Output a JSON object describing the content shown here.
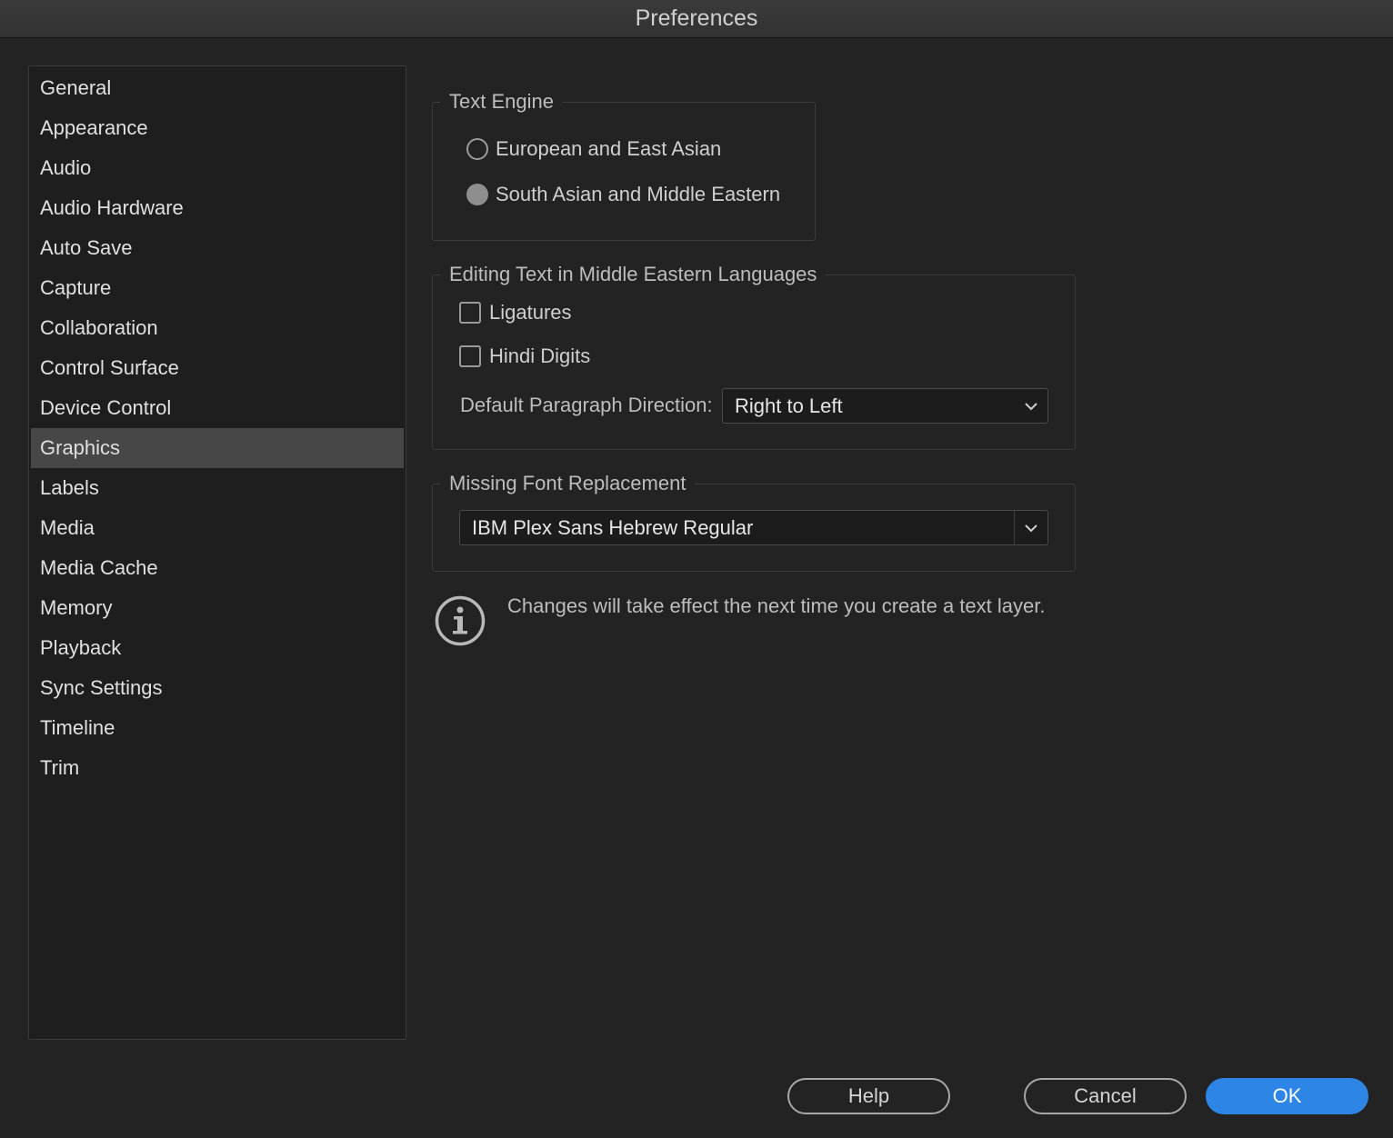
{
  "window": {
    "title": "Preferences"
  },
  "sidebar": {
    "items": [
      {
        "label": "General"
      },
      {
        "label": "Appearance"
      },
      {
        "label": "Audio"
      },
      {
        "label": "Audio Hardware"
      },
      {
        "label": "Auto Save"
      },
      {
        "label": "Capture"
      },
      {
        "label": "Collaboration"
      },
      {
        "label": "Control Surface"
      },
      {
        "label": "Device Control"
      },
      {
        "label": "Graphics"
      },
      {
        "label": "Labels"
      },
      {
        "label": "Media"
      },
      {
        "label": "Media Cache"
      },
      {
        "label": "Memory"
      },
      {
        "label": "Playback"
      },
      {
        "label": "Sync Settings"
      },
      {
        "label": "Timeline"
      },
      {
        "label": "Trim"
      }
    ],
    "selected": "Graphics"
  },
  "text_engine": {
    "legend": "Text Engine",
    "options": [
      {
        "label": "European and East Asian",
        "checked": false
      },
      {
        "label": "South Asian and Middle Eastern",
        "checked": true
      }
    ]
  },
  "middle_eastern": {
    "legend": "Editing Text in Middle Eastern Languages",
    "ligatures_label": "Ligatures",
    "ligatures_checked": false,
    "hindi_digits_label": "Hindi Digits",
    "hindi_digits_checked": false,
    "direction_label": "Default Paragraph Direction:",
    "direction_value": "Right to Left"
  },
  "missing_font": {
    "legend": "Missing Font Replacement",
    "value": "IBM Plex Sans Hebrew Regular"
  },
  "info": {
    "icon": "info-icon",
    "text": "Changes will take effect the next time you create a text layer."
  },
  "buttons": {
    "help": "Help",
    "cancel": "Cancel",
    "ok": "OK"
  },
  "colors": {
    "accent": "#2d86e5",
    "background": "#232323",
    "selected_item": "#474747"
  }
}
